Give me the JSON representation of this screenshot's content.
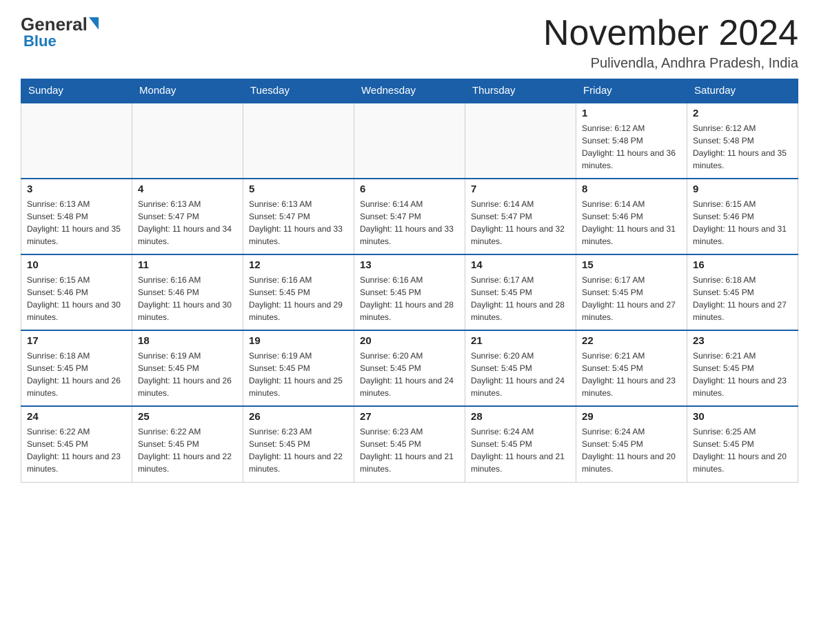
{
  "logo": {
    "general": "General",
    "blue": "Blue"
  },
  "title": "November 2024",
  "location": "Pulivendla, Andhra Pradesh, India",
  "days_of_week": [
    "Sunday",
    "Monday",
    "Tuesday",
    "Wednesday",
    "Thursday",
    "Friday",
    "Saturday"
  ],
  "weeks": [
    [
      {
        "day": "",
        "info": ""
      },
      {
        "day": "",
        "info": ""
      },
      {
        "day": "",
        "info": ""
      },
      {
        "day": "",
        "info": ""
      },
      {
        "day": "",
        "info": ""
      },
      {
        "day": "1",
        "info": "Sunrise: 6:12 AM\nSunset: 5:48 PM\nDaylight: 11 hours and 36 minutes."
      },
      {
        "day": "2",
        "info": "Sunrise: 6:12 AM\nSunset: 5:48 PM\nDaylight: 11 hours and 35 minutes."
      }
    ],
    [
      {
        "day": "3",
        "info": "Sunrise: 6:13 AM\nSunset: 5:48 PM\nDaylight: 11 hours and 35 minutes."
      },
      {
        "day": "4",
        "info": "Sunrise: 6:13 AM\nSunset: 5:47 PM\nDaylight: 11 hours and 34 minutes."
      },
      {
        "day": "5",
        "info": "Sunrise: 6:13 AM\nSunset: 5:47 PM\nDaylight: 11 hours and 33 minutes."
      },
      {
        "day": "6",
        "info": "Sunrise: 6:14 AM\nSunset: 5:47 PM\nDaylight: 11 hours and 33 minutes."
      },
      {
        "day": "7",
        "info": "Sunrise: 6:14 AM\nSunset: 5:47 PM\nDaylight: 11 hours and 32 minutes."
      },
      {
        "day": "8",
        "info": "Sunrise: 6:14 AM\nSunset: 5:46 PM\nDaylight: 11 hours and 31 minutes."
      },
      {
        "day": "9",
        "info": "Sunrise: 6:15 AM\nSunset: 5:46 PM\nDaylight: 11 hours and 31 minutes."
      }
    ],
    [
      {
        "day": "10",
        "info": "Sunrise: 6:15 AM\nSunset: 5:46 PM\nDaylight: 11 hours and 30 minutes."
      },
      {
        "day": "11",
        "info": "Sunrise: 6:16 AM\nSunset: 5:46 PM\nDaylight: 11 hours and 30 minutes."
      },
      {
        "day": "12",
        "info": "Sunrise: 6:16 AM\nSunset: 5:45 PM\nDaylight: 11 hours and 29 minutes."
      },
      {
        "day": "13",
        "info": "Sunrise: 6:16 AM\nSunset: 5:45 PM\nDaylight: 11 hours and 28 minutes."
      },
      {
        "day": "14",
        "info": "Sunrise: 6:17 AM\nSunset: 5:45 PM\nDaylight: 11 hours and 28 minutes."
      },
      {
        "day": "15",
        "info": "Sunrise: 6:17 AM\nSunset: 5:45 PM\nDaylight: 11 hours and 27 minutes."
      },
      {
        "day": "16",
        "info": "Sunrise: 6:18 AM\nSunset: 5:45 PM\nDaylight: 11 hours and 27 minutes."
      }
    ],
    [
      {
        "day": "17",
        "info": "Sunrise: 6:18 AM\nSunset: 5:45 PM\nDaylight: 11 hours and 26 minutes."
      },
      {
        "day": "18",
        "info": "Sunrise: 6:19 AM\nSunset: 5:45 PM\nDaylight: 11 hours and 26 minutes."
      },
      {
        "day": "19",
        "info": "Sunrise: 6:19 AM\nSunset: 5:45 PM\nDaylight: 11 hours and 25 minutes."
      },
      {
        "day": "20",
        "info": "Sunrise: 6:20 AM\nSunset: 5:45 PM\nDaylight: 11 hours and 24 minutes."
      },
      {
        "day": "21",
        "info": "Sunrise: 6:20 AM\nSunset: 5:45 PM\nDaylight: 11 hours and 24 minutes."
      },
      {
        "day": "22",
        "info": "Sunrise: 6:21 AM\nSunset: 5:45 PM\nDaylight: 11 hours and 23 minutes."
      },
      {
        "day": "23",
        "info": "Sunrise: 6:21 AM\nSunset: 5:45 PM\nDaylight: 11 hours and 23 minutes."
      }
    ],
    [
      {
        "day": "24",
        "info": "Sunrise: 6:22 AM\nSunset: 5:45 PM\nDaylight: 11 hours and 23 minutes."
      },
      {
        "day": "25",
        "info": "Sunrise: 6:22 AM\nSunset: 5:45 PM\nDaylight: 11 hours and 22 minutes."
      },
      {
        "day": "26",
        "info": "Sunrise: 6:23 AM\nSunset: 5:45 PM\nDaylight: 11 hours and 22 minutes."
      },
      {
        "day": "27",
        "info": "Sunrise: 6:23 AM\nSunset: 5:45 PM\nDaylight: 11 hours and 21 minutes."
      },
      {
        "day": "28",
        "info": "Sunrise: 6:24 AM\nSunset: 5:45 PM\nDaylight: 11 hours and 21 minutes."
      },
      {
        "day": "29",
        "info": "Sunrise: 6:24 AM\nSunset: 5:45 PM\nDaylight: 11 hours and 20 minutes."
      },
      {
        "day": "30",
        "info": "Sunrise: 6:25 AM\nSunset: 5:45 PM\nDaylight: 11 hours and 20 minutes."
      }
    ]
  ]
}
